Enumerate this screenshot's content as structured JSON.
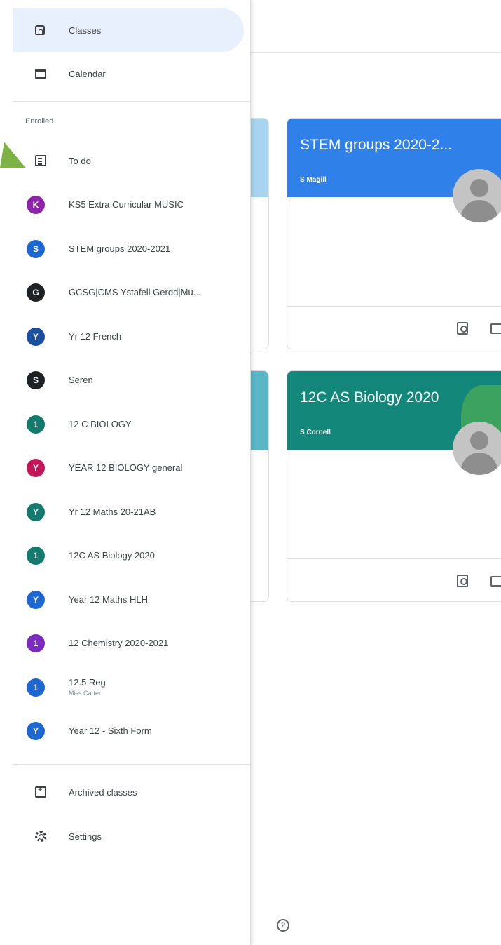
{
  "nav": {
    "classes_label": "Classes",
    "calendar_label": "Calendar",
    "enrolled_label": "Enrolled",
    "todo_label": "To do",
    "archived_label": "Archived classes",
    "settings_label": "Settings"
  },
  "classes": [
    {
      "initial": "K",
      "name": "KS5 Extra Curricular MUSIC",
      "color": "#8e24aa"
    },
    {
      "initial": "S",
      "name": "STEM groups 2020-2021",
      "color": "#1e66d0"
    },
    {
      "initial": "G",
      "name": "GCSG|CMS Ystafell Gerdd|Mu...",
      "color": "#202124"
    },
    {
      "initial": "Y",
      "name": "Yr 12 French",
      "color": "#1a4fa0"
    },
    {
      "initial": "S",
      "name": "Seren",
      "color": "#202124"
    },
    {
      "initial": "1",
      "name": "12 C BIOLOGY",
      "color": "#137a6e"
    },
    {
      "initial": "Y",
      "name": "YEAR 12 BIOLOGY general",
      "color": "#c2185b"
    },
    {
      "initial": "Y",
      "name": "Yr 12 Maths 20-21AB",
      "color": "#137a6e"
    },
    {
      "initial": "1",
      "name": "12C AS Biology 2020",
      "color": "#137a6e"
    },
    {
      "initial": "Y",
      "name": "Year 12 Maths HLH",
      "color": "#1e66d0"
    },
    {
      "initial": "1",
      "name": "12 Chemistry 2020-2021",
      "color": "#7b2cbf"
    },
    {
      "initial": "1",
      "name": "12.5 Reg",
      "subtitle": "Miss Carter",
      "color": "#1e66d0"
    },
    {
      "initial": "Y",
      "name": "Year 12 - Sixth Form",
      "color": "#1e66d0"
    }
  ],
  "cards": [
    {
      "title": "STEM groups 2020-2...",
      "teacher": "S Magill",
      "color": "#2f80e8"
    },
    {
      "title": "12C AS Biology 2020",
      "teacher": "S Cornell",
      "color": "#12877a"
    }
  ],
  "help_label": "?"
}
